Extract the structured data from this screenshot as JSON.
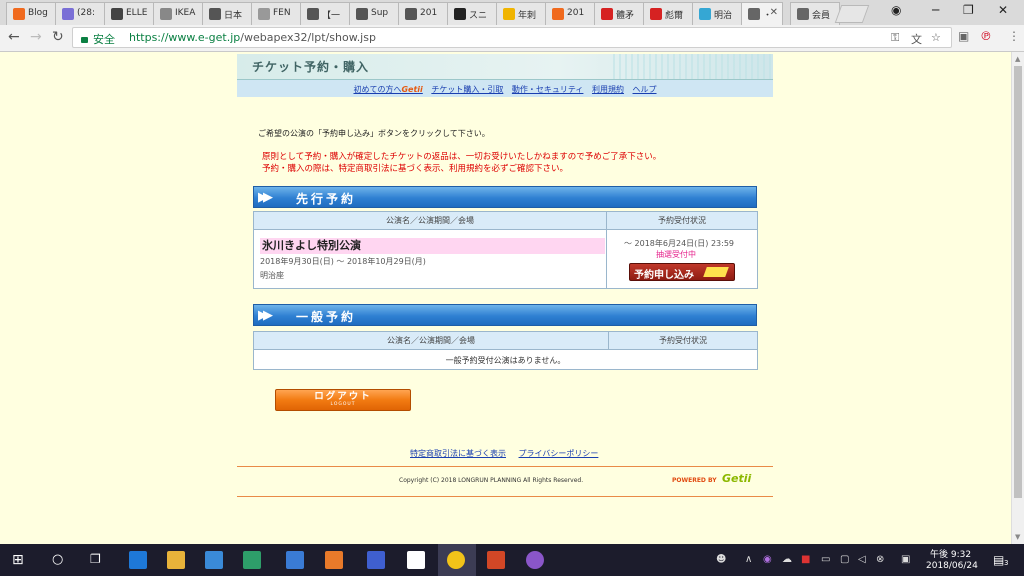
{
  "browser": {
    "tabs": [
      {
        "label": "Blog",
        "color": "#f06a1e"
      },
      {
        "label": "(28:",
        "color": "#7a6fd6"
      },
      {
        "label": "ELLE",
        "color": "#444444"
      },
      {
        "label": "IKEA",
        "color": "#888888"
      },
      {
        "label": "日本",
        "color": "#555555"
      },
      {
        "label": "FEN",
        "color": "#999999"
      },
      {
        "label": "【一",
        "color": "#555555"
      },
      {
        "label": "Sup",
        "color": "#555555"
      },
      {
        "label": "201",
        "color": "#555555"
      },
      {
        "label": "スニ",
        "color": "#222222"
      },
      {
        "label": "年刺",
        "color": "#f0b400"
      },
      {
        "label": "201",
        "color": "#f06a1e"
      },
      {
        "label": "體矛",
        "color": "#d62222"
      },
      {
        "label": "彪爾",
        "color": "#d62222"
      },
      {
        "label": "明治",
        "color": "#35a7d4"
      },
      {
        "label": "・",
        "color": "#666666"
      },
      {
        "label": "会員",
        "color": "#666666"
      }
    ],
    "security_label": "安全",
    "url_host": "https://www.e-get.jp",
    "url_path": "/webapex32/lpt/show.jsp"
  },
  "page": {
    "header_title": "チケット予約・購入",
    "subnav": {
      "first_time": "初めての方へ",
      "getii": "Getii",
      "purchase": "チケット購入・引取",
      "environment": "動作・セキュリティ",
      "terms": "利用規約",
      "help": "ヘルプ"
    },
    "intro": "ご希望の公演の「予約申し込み」ボタンをクリックして下さい。",
    "warning_line1": "原則として予約・購入が確定したチケットの返品は、一切お受けいたしかねますので予めご了承下さい。",
    "warning_line2": "予約・購入の際は、特定商取引法に基づく表示、利用規約を必ずご確認下さい。",
    "advance": {
      "title": "先行予約",
      "col_performance": "公演名／公演期間／会場",
      "col_status": "予約受付状況",
      "performance_name": "氷川きよし特別公演",
      "period": "2018年9月30日(日) 〜 2018年10月29日(月)",
      "venue": "明治座",
      "deadline": "〜 2018年6月24日(日) 23:59",
      "status": "抽選受付中",
      "apply_button": "予約申し込み"
    },
    "general": {
      "title": "一般予約",
      "col_performance": "公演名／公演期間／会場",
      "col_status": "予約受付状況",
      "empty_message": "一般予約受付公演はありません。"
    },
    "logout_label": "ログアウト",
    "logout_sub": "LOGOUT",
    "footer_links": [
      "特定商取引法に基づく表示",
      "プライバシーポリシー"
    ],
    "copyright": "Copyright (C) 2018 LONGRUN PLANNING All Rights Reserved.",
    "powered_by": "POWERED BY",
    "logo": "Getii"
  },
  "taskbar": {
    "time": "午後 9:32",
    "date": "2018/06/24",
    "notifications": "3"
  }
}
